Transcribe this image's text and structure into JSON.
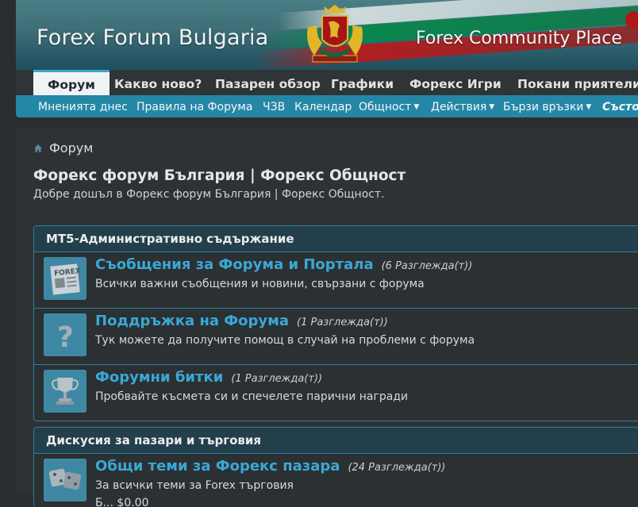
{
  "banner": {
    "title_left": "Forex Forum Bulgaria",
    "title_right": "Forex Community Place"
  },
  "topnav": [
    {
      "label": "Форум",
      "active": true
    },
    {
      "label": "Какво ново?"
    },
    {
      "label": "Пазарен обзор"
    },
    {
      "label": "Графики"
    },
    {
      "label": "Форекс Игри"
    },
    {
      "label": "Покани приятели"
    }
  ],
  "subnav": [
    {
      "label": "Мненията днес"
    },
    {
      "label": "Правила на Форума"
    },
    {
      "label": "ЧЗВ"
    },
    {
      "label": "Календар"
    },
    {
      "label": "Общност",
      "dropdown": true
    },
    {
      "label": "Действия",
      "dropdown": true
    },
    {
      "label": "Бързи връзки",
      "dropdown": true
    },
    {
      "label": "Състо"
    }
  ],
  "breadcrumb": "Форум",
  "page": {
    "title": "Форекс форум България | Форекс Общност",
    "description": "Добре дошъл в Форекс форум България | Форекс Общност."
  },
  "categories": [
    {
      "title": "MT5-Административно съдържание",
      "forums": [
        {
          "title": "Съобщения за Форума и Портала",
          "views": "(6 Разглежда(т))",
          "description": "Всички важни съобщения и новини, свързани с форума",
          "icon": "forex-newspaper-icon"
        },
        {
          "title": "Поддръжка на Форума",
          "views": "(1 Разглежда(т))",
          "description": "Тук можете да получите помощ в случай на проблеми с форума",
          "icon": "question-mark-icon"
        },
        {
          "title": "Форумни битки",
          "views": "(1 Разглежда(т))",
          "description": "Пробвайте късмета си и спечелете парични награди",
          "icon": "trophy-icon"
        }
      ]
    },
    {
      "title": "Дискусия за пазари и търговия",
      "forums": [
        {
          "title": "Общи теми за Форекс пазара",
          "views": "(24 Разглежда(т))",
          "description": "За всички теми за Forex търговия",
          "extra": "Б... $0.00",
          "icon": "dice-icon"
        }
      ]
    }
  ]
}
